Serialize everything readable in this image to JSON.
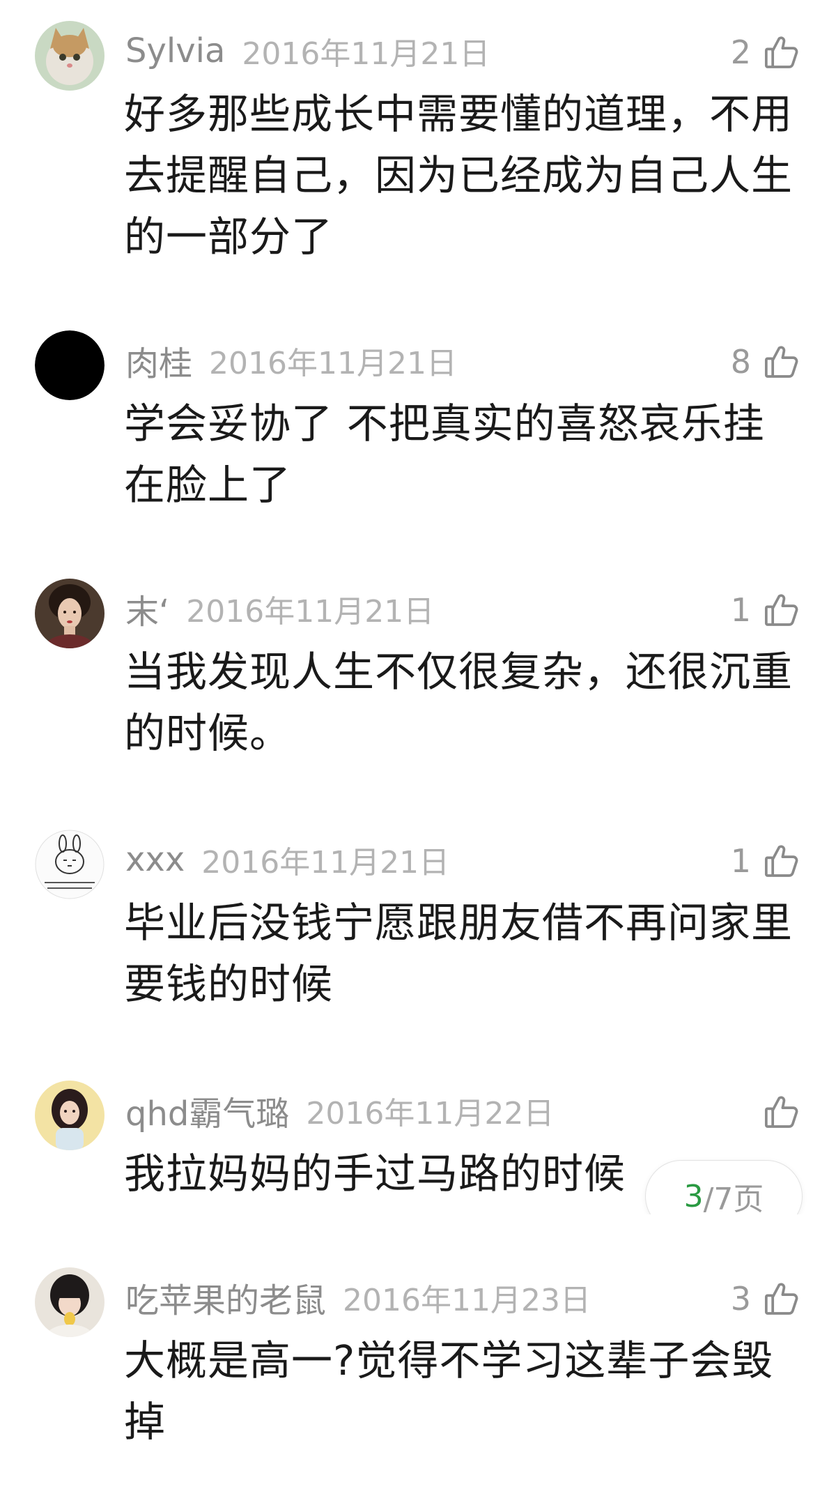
{
  "comments": [
    {
      "user": "Sylvia",
      "date": "2016年11月21日",
      "likes": "2",
      "text": "好多那些成长中需要懂的道理，不用去提醒自己，因为已经成为自己人生的一部分了"
    },
    {
      "user": "肉桂",
      "date": "2016年11月21日",
      "likes": "8",
      "text": "学会妥协了 不把真实的喜怒哀乐挂在脸上了"
    },
    {
      "user": "末‘",
      "date": "2016年11月21日",
      "likes": "1",
      "text": "当我发现人生不仅很复杂，还很沉重的时候。"
    },
    {
      "user": "xxx",
      "date": "2016年11月21日",
      "likes": "1",
      "text": "毕业后没钱宁愿跟朋友借不再问家里要钱的时候"
    },
    {
      "user": "qhd霸气璐",
      "date": "2016年11月22日",
      "likes": "",
      "text": "我拉妈妈的手过马路的时候"
    },
    {
      "user": "吃苹果的老鼠",
      "date": "2016年11月23日",
      "likes": "3",
      "text": "大概是高一?觉得不学习这辈子会毁掉"
    }
  ],
  "pager": {
    "current": "3",
    "rest": "/7页"
  },
  "colors": {
    "pager_current": "#2a9a42",
    "username": "#8c8c8c",
    "date": "#b3b3b3",
    "text": "#1a1a1a"
  },
  "icons": {
    "like": "thumbs-up-icon"
  }
}
